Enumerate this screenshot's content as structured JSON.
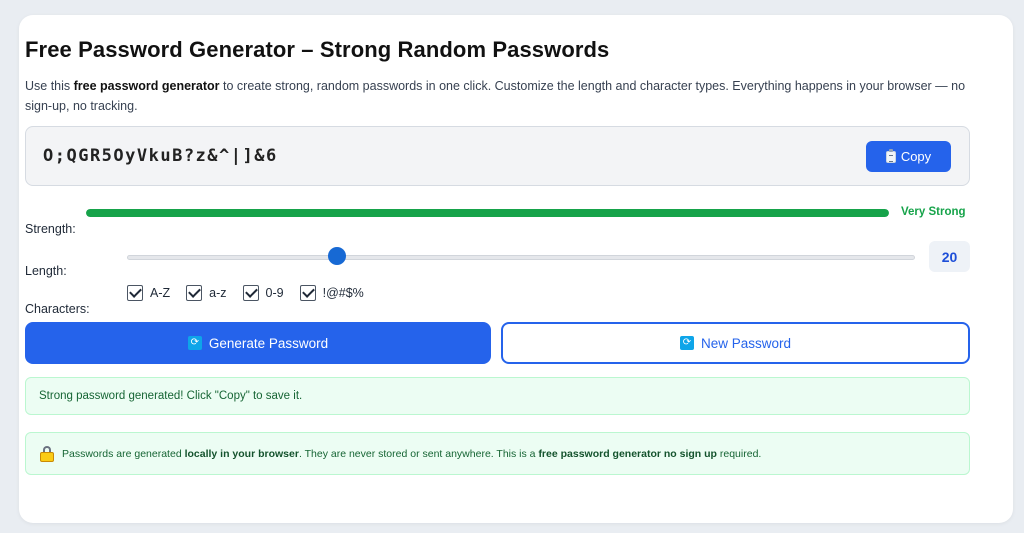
{
  "title": "Free Password Generator – Strong Random Passwords",
  "intro": {
    "part1": "Use this ",
    "bold": "free password generator",
    "part2": " to create strong, random passwords in one click. Customize the length and character types. Everything happens in your browser — no sign-up, no tracking."
  },
  "password": "O;QGR5OyVkuB?z&^|]&6",
  "copy_label": "Copy",
  "strength": {
    "label": "Strength:",
    "value_text": "Very Strong",
    "fraction": 1.0,
    "color": "#16a34a"
  },
  "length": {
    "label": "Length:",
    "value": "20",
    "min": 4,
    "max": 64
  },
  "characters": {
    "label": "Characters:",
    "options": [
      {
        "label": "A-Z",
        "checked": true
      },
      {
        "label": "a-z",
        "checked": true
      },
      {
        "label": "0-9",
        "checked": true
      },
      {
        "label": "!@#$%",
        "checked": true
      }
    ]
  },
  "generate_label": "Generate Password",
  "new_label": "New Password",
  "status": "Strong password generated! Click \"Copy\" to save it.",
  "info": {
    "t1": "Passwords are generated ",
    "b1": "locally in your browser",
    "t2": ". They are never stored or sent anywhere. This is a ",
    "b2": "free password generator no sign up",
    "t3": " required."
  },
  "colors": {
    "accent": "#2563eb",
    "success": "#16a34a",
    "success_bg": "#ecfdf3"
  },
  "icons": {
    "copy": "clipboard-icon",
    "generate": "refresh-icon",
    "info": "lock-icon"
  }
}
